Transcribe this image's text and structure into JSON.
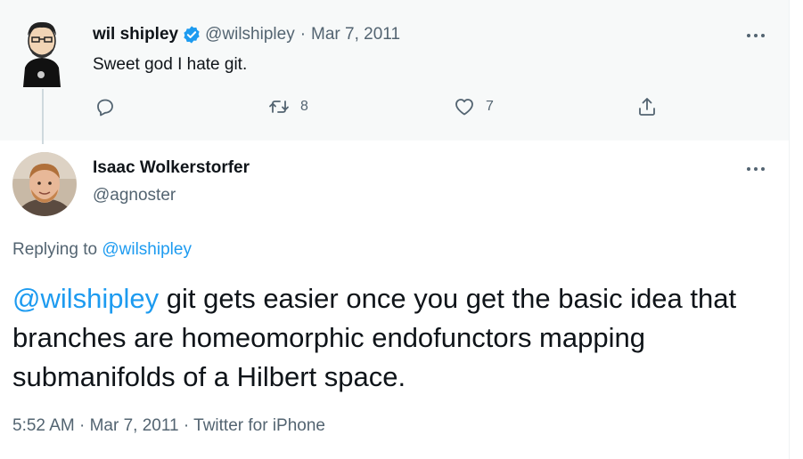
{
  "parent_tweet": {
    "author_name": "wil shipley",
    "handle": "@wilshipley",
    "separator": "·",
    "date": "Mar 7, 2011",
    "text": "Sweet god I hate git.",
    "actions": {
      "reply_icon": "reply-icon",
      "retweet_icon": "retweet-icon",
      "retweet_count": "8",
      "like_icon": "heart-icon",
      "like_count": "7",
      "share_icon": "share-icon"
    }
  },
  "reply_tweet": {
    "author_name": "Isaac Wolkerstorfer",
    "handle": "@agnoster",
    "replying_prefix": "Replying to",
    "replying_to": "@wilshipley",
    "mention": "@wilshipley",
    "text": " git gets easier once you get the basic idea that branches are homeomorphic endofunctors mapping submanifolds of a Hilbert space.",
    "time": "5:52 AM",
    "date": "Mar 7, 2011",
    "source": "Twitter for iPhone",
    "separator": "·"
  },
  "colors": {
    "accent": "#1d9bf0",
    "secondary_text": "#536471",
    "primary_text": "#0f1419",
    "highlight_bg": "#f7f9f9"
  }
}
